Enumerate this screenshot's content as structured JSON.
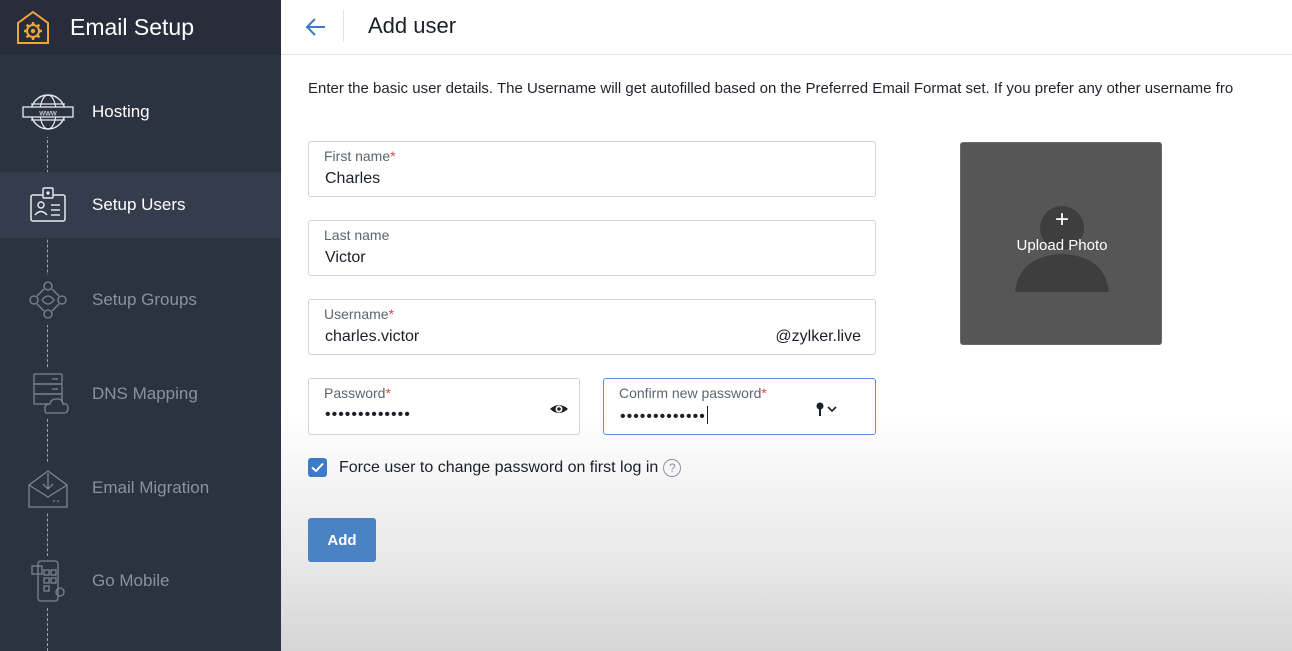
{
  "app": {
    "title": "Email Setup",
    "logo_icon": "gear-settings-icon"
  },
  "sidebar": {
    "items": [
      {
        "label": "Hosting",
        "icon": "globe-www-icon",
        "state": "completed"
      },
      {
        "label": "Setup Users",
        "icon": "id-card-icon",
        "state": "active"
      },
      {
        "label": "Setup Groups",
        "icon": "group-network-icon",
        "state": "pending"
      },
      {
        "label": "DNS Mapping",
        "icon": "server-cloud-icon",
        "state": "pending"
      },
      {
        "label": "Email Migration",
        "icon": "mail-inbox-icon",
        "state": "pending"
      },
      {
        "label": "Go Mobile",
        "icon": "mobile-qr-icon",
        "state": "pending"
      }
    ]
  },
  "header": {
    "back_icon": "arrow-left-icon",
    "title": "Add user"
  },
  "form": {
    "description": "Enter the basic user details. The Username will get autofilled based on the Preferred Email Format set. If you prefer any other username fro",
    "first_name": {
      "label": "First name",
      "required_mark": "*",
      "value": "Charles"
    },
    "last_name": {
      "label": "Last name",
      "value": "Victor"
    },
    "username": {
      "label": "Username",
      "required_mark": "*",
      "value": "charles.victor",
      "domain": "@zylker.live"
    },
    "password": {
      "label": "Password",
      "required_mark": "*",
      "masked_value": "•••••••••••••",
      "toggle_icon": "eye-icon"
    },
    "confirm_password": {
      "label": "Confirm new password",
      "required_mark": "*",
      "masked_value": "•••••••••••••",
      "suggest_icon": "key-dropdown-icon"
    },
    "force_change": {
      "label": "Force user to change password on first log in",
      "checked": true,
      "help": "?"
    },
    "add_button": "Add"
  },
  "photo": {
    "plus": "+",
    "label": "Upload Photo",
    "icon": "person-silhouette-icon"
  },
  "colors": {
    "sidebar": "#2b3240",
    "accent": "#4a82c6",
    "required": "#e04848"
  }
}
